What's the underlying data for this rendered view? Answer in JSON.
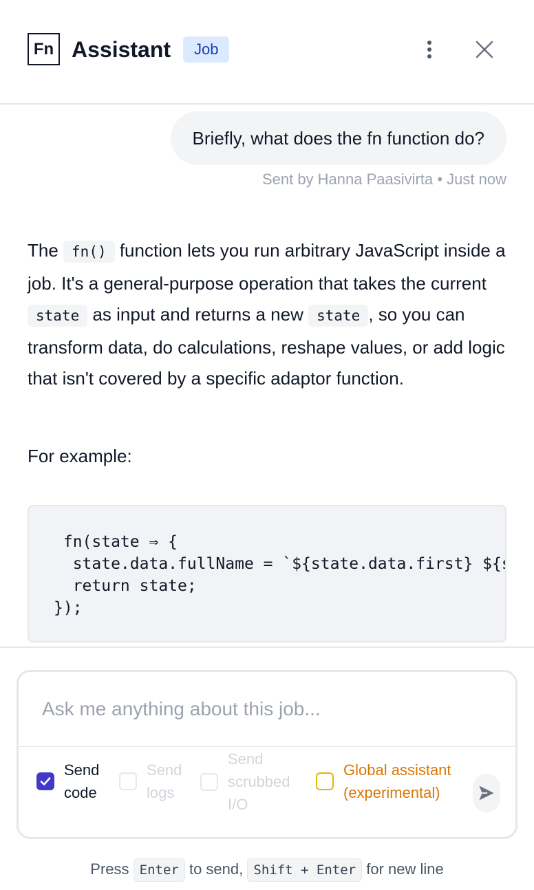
{
  "header": {
    "logo_text": "Fn",
    "title": "Assistant",
    "badge": "Job"
  },
  "messages": {
    "user": {
      "text": "Briefly, what does the fn function do?",
      "sent_by": "Sent by Hanna Paasivirta",
      "separator": "•",
      "time": "Just now"
    },
    "assistant": {
      "part1": "The ",
      "code1": "fn()",
      "part2": " function lets you run arbitrary JavaScript inside a job. It's a general-purpose operation that takes the current ",
      "code2": "state",
      "part3": " as input and returns a new ",
      "code3": "state",
      "part4": ", so you can transform data, do calculations, reshape values, or add logic that isn't covered by a specific adaptor function.",
      "example_intro": "For example:",
      "code_block": " fn(state ⇒ {\n  state.data.fullName = `${state.data.first} ${state.data.last}`;\n  return state;\n});"
    }
  },
  "composer": {
    "placeholder": "Ask me anything about this job...",
    "options": {
      "send_code": {
        "line1": "Send",
        "line2": "code",
        "checked": true
      },
      "send_logs": {
        "line1": "Send",
        "line2": "logs",
        "checked": false
      },
      "send_io": {
        "line1": "Send",
        "line2": "scrubbed",
        "line3": "I/O",
        "checked": false
      },
      "global": {
        "line1": "Global assistant",
        "line2": "(experimental)",
        "checked": false
      }
    }
  },
  "hint": {
    "press": "Press",
    "key1": "Enter",
    "to_send": "to send,",
    "key2": "Shift + Enter",
    "new_line": "for new line"
  },
  "colors": {
    "accent": "#4338ca",
    "badge_bg": "#dbeafe",
    "badge_text": "#1e40af",
    "warning": "#d97706"
  }
}
